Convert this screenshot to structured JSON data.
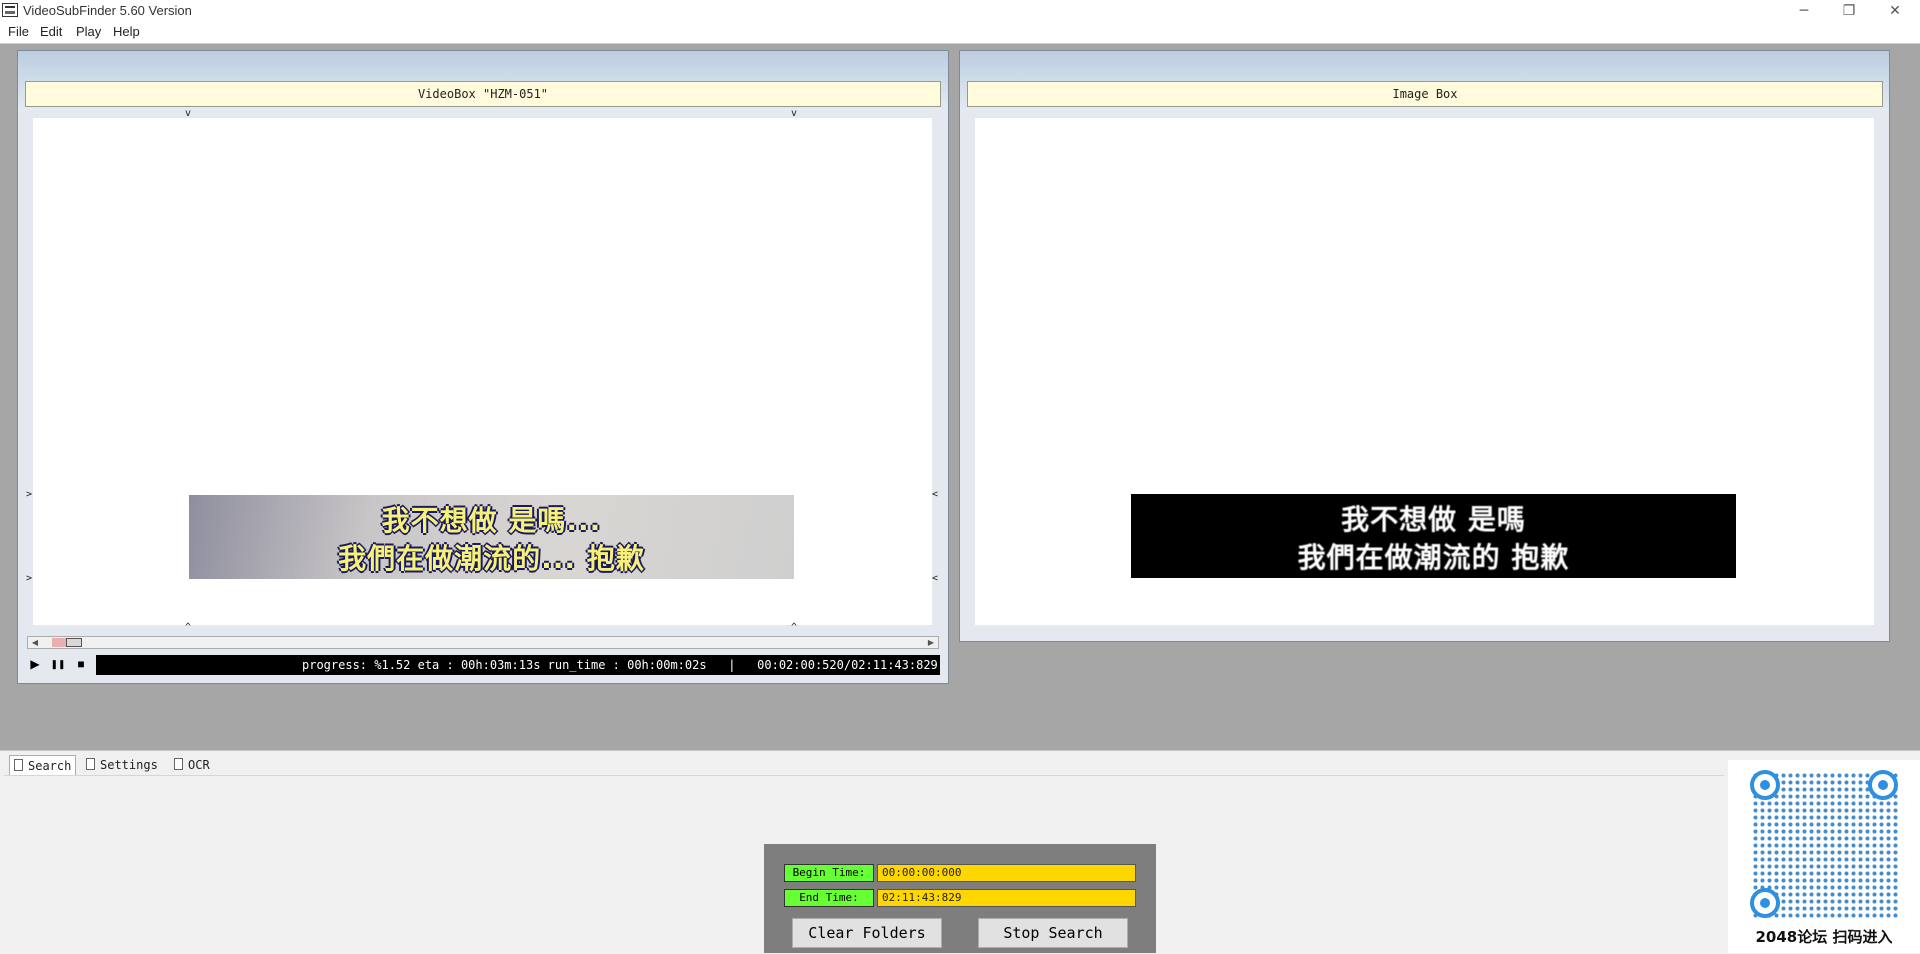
{
  "window": {
    "title": "VideoSubFinder 5.60 Version",
    "minimize": "─",
    "restore": "❐",
    "close": "✕"
  },
  "menu": [
    "File",
    "Edit",
    "Play",
    "Help"
  ],
  "video_box": {
    "header": "VideoBox \"HZM-051\"",
    "subtitle_line1": "我不想做 是嗎...",
    "subtitle_line2": "我們在做潮流的... 抱歉",
    "marker_down": "v",
    "marker_up": "^",
    "marker_right": ">",
    "marker_left": "<",
    "scroll_left": "◀",
    "scroll_right": "▶",
    "play": "▶",
    "pause": "❚❚",
    "stop": "■",
    "status": "progress: %1.52 eta : 00h:03m:13s run_time : 00h:00m:02s   |   00:02:00:520/02:11:43:829"
  },
  "image_box": {
    "header": "Image Box",
    "bin_line1": "我不想做 是嗎",
    "bin_line2": "我們在做潮流的    抱歉"
  },
  "tabs": [
    "Search",
    "Settings",
    "OCR"
  ],
  "search_panel": {
    "begin_label": "Begin Time:",
    "begin_value": "00:00:00:000",
    "end_label": "End Time:",
    "end_value": "02:11:43:829",
    "clear_button": "Clear Folders",
    "stop_button": "Stop Search"
  },
  "qr": {
    "caption": "2048论坛 扫码进入"
  },
  "colors": {
    "field_label_bg": "#66ff33",
    "field_input_bg": "#ffd700",
    "panel_header_bg": "#fffbdc"
  }
}
